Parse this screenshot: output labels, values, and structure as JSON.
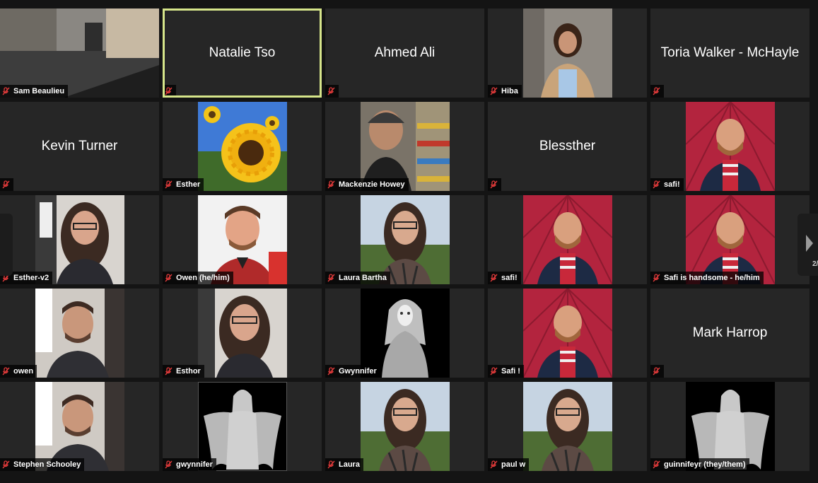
{
  "participants": [
    {
      "name": "Sam Beaulieu",
      "display": ""
    },
    {
      "name": "",
      "display": "Natalie Tso"
    },
    {
      "name": "",
      "display": "Ahmed Ali"
    },
    {
      "name": "Hiba",
      "display": ""
    },
    {
      "name": "",
      "display": "Toria Walker - McHayle"
    },
    {
      "name": "",
      "display": "Kevin Turner"
    },
    {
      "name": "Esther",
      "display": ""
    },
    {
      "name": "Mackenzie Howey",
      "display": ""
    },
    {
      "name": "",
      "display": "Blessther"
    },
    {
      "name": "safi!",
      "display": ""
    },
    {
      "name": "Esther-v2",
      "display": ""
    },
    {
      "name": "Owen (he/him)",
      "display": ""
    },
    {
      "name": "Laura Bartha",
      "display": ""
    },
    {
      "name": "safi!",
      "display": ""
    },
    {
      "name": "Safi is handsome - he/him",
      "display": ""
    },
    {
      "name": "owen",
      "display": ""
    },
    {
      "name": "Esthor",
      "display": ""
    },
    {
      "name": "Gwynnifer",
      "display": ""
    },
    {
      "name": "Safi !",
      "display": ""
    },
    {
      "name": "",
      "display": "Mark Harrop"
    },
    {
      "name": "Stephen Schooley",
      "display": ""
    },
    {
      "name": "gwynnifer",
      "display": ""
    },
    {
      "name": "Laura",
      "display": ""
    },
    {
      "name": "paul w",
      "display": ""
    },
    {
      "name": "guinnifeyr (they/them)",
      "display": ""
    }
  ],
  "pager": {
    "page": "2/"
  },
  "colors": {
    "active_speaker_border": "#d6e58a",
    "tile_bg": "#262626",
    "muted_icon": "#e03a3a"
  }
}
